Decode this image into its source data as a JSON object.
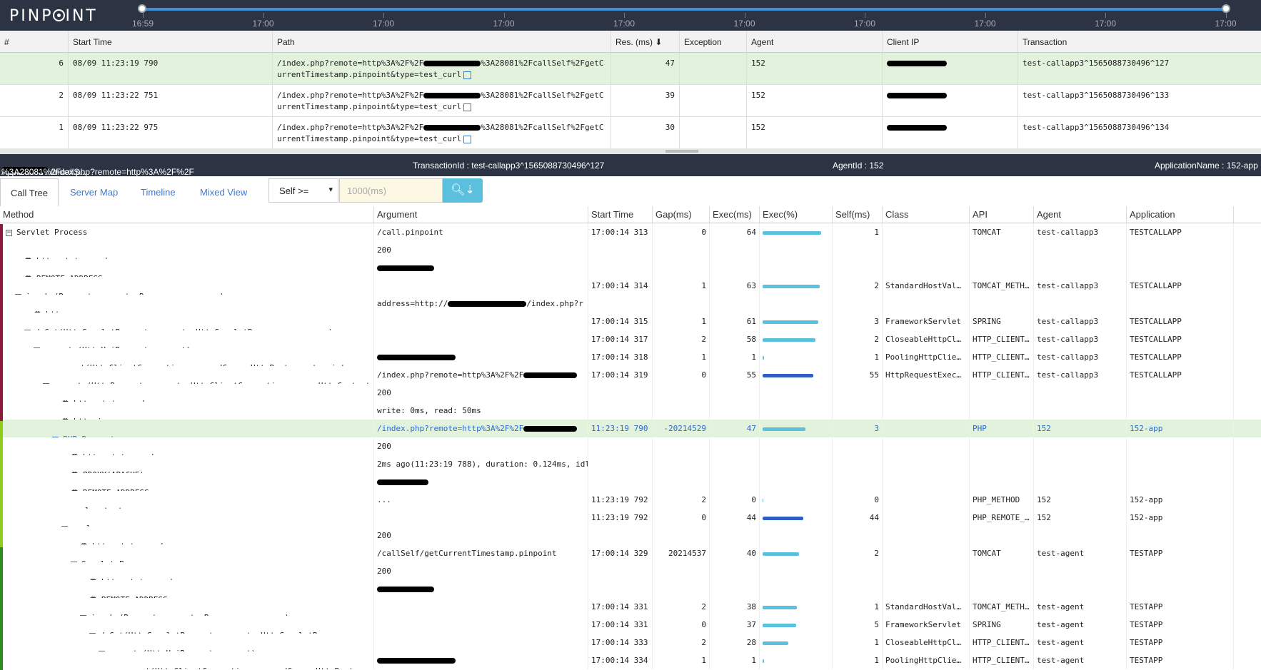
{
  "app": {
    "logo_pre": "PINP",
    "logo_post": "INT"
  },
  "timeline": {
    "ticks": [
      "16:59",
      "17:00",
      "17:00",
      "17:00",
      "17:00",
      "17:00",
      "17:00",
      "17:00",
      "17:00",
      "17:00"
    ]
  },
  "list": {
    "headers": [
      "#",
      "Start Time",
      "Path",
      "Res. (ms) ⬇",
      "Exception",
      "Agent",
      "Client IP",
      "Transaction"
    ],
    "rows": [
      {
        "num": "6",
        "start": "08/09 11:23:19 790",
        "path_a": "/index.php?remote=http%3A%2F%2F",
        "path_b": "%3A28081%2FcallSelf%2FgetCurrentTimestamp.pinpoint&type=test_curl",
        "res": "47",
        "exception": "",
        "agent": "152",
        "tx": "test-callapp3^1565088730496^127"
      },
      {
        "num": "2",
        "start": "08/09 11:23:22 751",
        "path_a": "/index.php?remote=http%3A%2F%2F",
        "path_b": "%3A28081%2FcallSelf%2FgetCurrentTimestamp.pinpoint&type=test_curl",
        "res": "39",
        "exception": "",
        "agent": "152",
        "tx": "test-callapp3^1565088730496^133"
      },
      {
        "num": "1",
        "start": "08/09 11:23:22 975",
        "path_a": "/index.php?remote=http%3A%2F%2F",
        "path_b": "%3A28081%2FcallSelf%2FgetCurrentTimestamp.pinpoint&type=test_curl",
        "res": "30",
        "exception": "",
        "agent": "152",
        "tx": "test-callapp3^1565088730496^134"
      }
    ]
  },
  "info": {
    "app_a": "Application : /index.php?remote=http%3A%2F%2F",
    "app_b": "%3A28081%2FcallS...",
    "tx": "TransactionId : test-callapp3^1565088730496^127",
    "agent": "AgentId : 152",
    "name": "ApplicationName : 152-app"
  },
  "tabs": [
    "Call Tree",
    "Server Map",
    "Timeline",
    "Mixed View"
  ],
  "filter": {
    "self": "Self >=",
    "placeholder": "1000(ms)"
  },
  "calltree": {
    "headers": [
      "Method",
      "Argument",
      "Start Time",
      "Gap(ms)",
      "Exec(ms)",
      "Exec(%)",
      "Self(ms)",
      "Class",
      "API",
      "Agent",
      "Application"
    ],
    "rows": [
      {
        "d": 0,
        "t": "box",
        "m": "Servlet Process",
        "a": "/call.pinpoint",
        "s": "17:00:14 313",
        "g": "0",
        "e": "64",
        "p": 100,
        "sf": "1",
        "c": "",
        "api": "TOMCAT",
        "ag": "test-callapp3",
        "ap": "TESTCALLAPP"
      },
      {
        "d": 2,
        "t": "info",
        "m": "http.status.code",
        "a": "200"
      },
      {
        "d": 2,
        "t": "info",
        "m": "REMOTE_ADDRESS",
        "a": "",
        "red": 80
      },
      {
        "d": 1,
        "t": "box",
        "m": "invoke(Request request, Response response)",
        "a": "",
        "s": "17:00:14 314",
        "g": "1",
        "e": "63",
        "p": 98,
        "sf": "2",
        "c": "StandardHostVal…",
        "api": "TOMCAT_METH…",
        "ag": "test-callapp3",
        "ap": "TESTCALLAPP"
      },
      {
        "d": 3,
        "t": "info",
        "m": "http.param",
        "a": "address=http://",
        "red": 110,
        "a2": "/index.php?r"
      },
      {
        "d": 2,
        "t": "box",
        "m": "doGet(HttpServletRequest request, HttpServletResponse response)",
        "a": "",
        "s": "17:00:14 315",
        "g": "1",
        "e": "61",
        "p": 95,
        "sf": "3",
        "c": "FrameworkServlet",
        "api": "SPRING",
        "ag": "test-callapp3",
        "ap": "TESTCALLAPP"
      },
      {
        "d": 3,
        "t": "box",
        "m": "execute(HttpUriRequest request)",
        "a": "",
        "s": "17:00:14 317",
        "g": "2",
        "e": "58",
        "p": 90,
        "sf": "2",
        "c": "CloseableHttpCl…",
        "api": "HTTP_CLIENT…",
        "ag": "test-callapp3",
        "ap": "TESTCALLAPP"
      },
      {
        "d": 5,
        "t": "none",
        "m": "connect(HttpClientConnection managedConn, HttpRoute route, int conn",
        "a": "",
        "red": 110,
        "s": "17:00:14 318",
        "g": "1",
        "e": "1",
        "p": 2,
        "sf": "1",
        "c": "PoolingHttpClie…",
        "api": "HTTP_CLIENT…",
        "ag": "test-callapp3",
        "ap": "TESTCALLAPP"
      },
      {
        "d": 4,
        "t": "box",
        "m": "execute(HttpRequest request, HttpClientConnection conn, HttpContext",
        "a": "/index.php?remote=http%3A%2F%2F",
        "red": 75,
        "s": "17:00:14 319",
        "g": "0",
        "e": "55",
        "p": 86,
        "dark": true,
        "sf": "55",
        "c": "HttpRequestExec…",
        "api": "HTTP_CLIENT…",
        "ag": "test-callapp3",
        "ap": "TESTCALLAPP"
      },
      {
        "d": 6,
        "t": "info",
        "m": "http.status.code",
        "a": "200"
      },
      {
        "d": 6,
        "t": "info",
        "m": "http.io",
        "a": "write: 0ms, read: 50ms"
      },
      {
        "d": 5,
        "t": "box",
        "m": "PHP Request",
        "a": "/index.php?remote=http%3A%2F%2F",
        "red": 75,
        "s": "11:23:19 790",
        "g": "-20214529",
        "e": "47",
        "p": 73,
        "sf": "3",
        "c": "",
        "api": "PHP",
        "ag": "152",
        "ap": "152-app",
        "hl": true
      },
      {
        "d": 7,
        "t": "info",
        "m": "http.status.code",
        "a": "200"
      },
      {
        "d": 7,
        "t": "info",
        "m": "PROXY(APACHE)",
        "a": "2ms ago(11:23:19 788), duration: 0.124ms, idl"
      },
      {
        "d": 7,
        "t": "info",
        "m": "REMOTE_ADDRESS",
        "a": "",
        "red": 72
      },
      {
        "d": 7,
        "t": "none",
        "m": "curl_setopt",
        "a": "...",
        "s": "11:23:19 792",
        "g": "2",
        "e": "0",
        "p": 1,
        "sf": "0",
        "c": "",
        "api": "PHP_METHOD",
        "ag": "152",
        "ap": "152-app"
      },
      {
        "d": 6,
        "t": "box",
        "m": "curl_exec",
        "a": "",
        "s": "11:23:19 792",
        "g": "0",
        "e": "44",
        "p": 69,
        "dark": true,
        "sf": "44",
        "c": "",
        "api": "PHP_REMOTE_…",
        "ag": "152",
        "ap": "152-app"
      },
      {
        "d": 8,
        "t": "info",
        "m": "http.status.code",
        "a": "200"
      },
      {
        "d": 7,
        "t": "box",
        "m": "Servlet Process",
        "a": "/callSelf/getCurrentTimestamp.pinpoint",
        "s": "17:00:14 329",
        "g": "20214537",
        "e": "40",
        "p": 62,
        "sf": "2",
        "c": "",
        "api": "TOMCAT",
        "ag": "test-agent",
        "ap": "TESTAPP"
      },
      {
        "d": 9,
        "t": "info",
        "m": "http.status.code",
        "a": "200"
      },
      {
        "d": 9,
        "t": "info",
        "m": "REMOTE_ADDRESS",
        "a": "",
        "red": 80
      },
      {
        "d": 8,
        "t": "box",
        "m": "invoke(Request request, Response response)",
        "a": "",
        "s": "17:00:14 331",
        "g": "2",
        "e": "38",
        "p": 59,
        "sf": "1",
        "c": "StandardHostVal…",
        "api": "TOMCAT_METH…",
        "ag": "test-agent",
        "ap": "TESTAPP"
      },
      {
        "d": 9,
        "t": "box",
        "m": "doGet(HttpServletRequest request, HttpServletResponse r",
        "a": "",
        "s": "17:00:14 331",
        "g": "0",
        "e": "37",
        "p": 57,
        "sf": "5",
        "c": "FrameworkServlet",
        "api": "SPRING",
        "ag": "test-agent",
        "ap": "TESTAPP"
      },
      {
        "d": 10,
        "t": "box",
        "m": "execute(HttpUriRequest request)",
        "a": "",
        "s": "17:00:14 333",
        "g": "2",
        "e": "28",
        "p": 44,
        "sf": "1",
        "c": "CloseableHttpCl…",
        "api": "HTTP_CLIENT…",
        "ag": "test-agent",
        "ap": "TESTAPP"
      },
      {
        "d": 12,
        "t": "none",
        "m": "connect(HttpClientConnection managedConn, HttpRoute",
        "a": "",
        "red": 110,
        "s": "17:00:14 334",
        "g": "1",
        "e": "1",
        "p": 2,
        "sf": "1",
        "c": "PoolingHttpClie…",
        "api": "HTTP_CLIENT…",
        "ag": "test-agent",
        "ap": "TESTAPP"
      }
    ]
  }
}
